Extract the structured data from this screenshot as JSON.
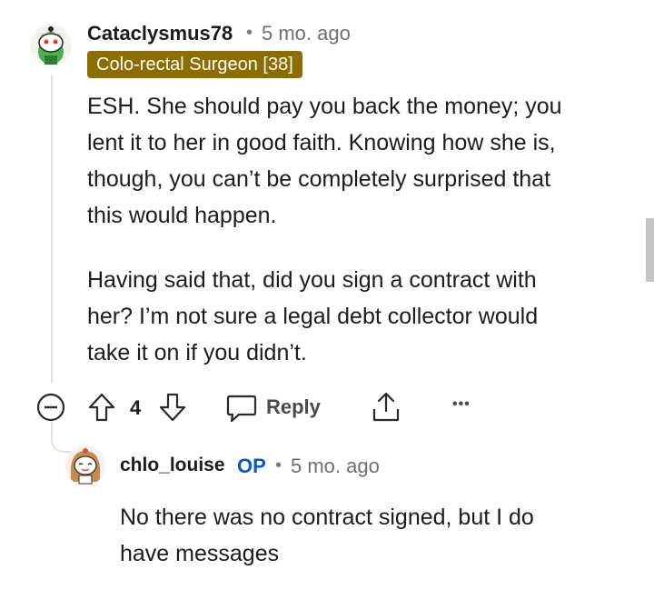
{
  "comment": {
    "username": "Cataclysmus78",
    "separator": "•",
    "age": "5 mo. ago",
    "flair": "Colo-rectal Surgeon [38]",
    "paragraphs": [
      [
        "ESH. She should pay you back the money; you",
        "lent it to her in good faith. Knowing how she is,",
        "though, you can’t be completely surprised that",
        "this would happen."
      ],
      [
        "Having said that, did you sign a contract with",
        "her? I’m not sure a legal debt collector would",
        "take it on if you didn’t."
      ]
    ],
    "actions": {
      "vote_count": "4",
      "reply_label": "Reply",
      "more_label": "•••"
    }
  },
  "reply": {
    "username": "chlo_louise",
    "op_badge": "OP",
    "separator": "•",
    "age": "5 mo. ago",
    "lines": [
      "No there was no contract signed, but I do",
      "have messages"
    ]
  },
  "colors": {
    "flair_bg": "#8c6d00",
    "op_blue": "#0b57c4",
    "thread_line": "#e3e3e3"
  }
}
